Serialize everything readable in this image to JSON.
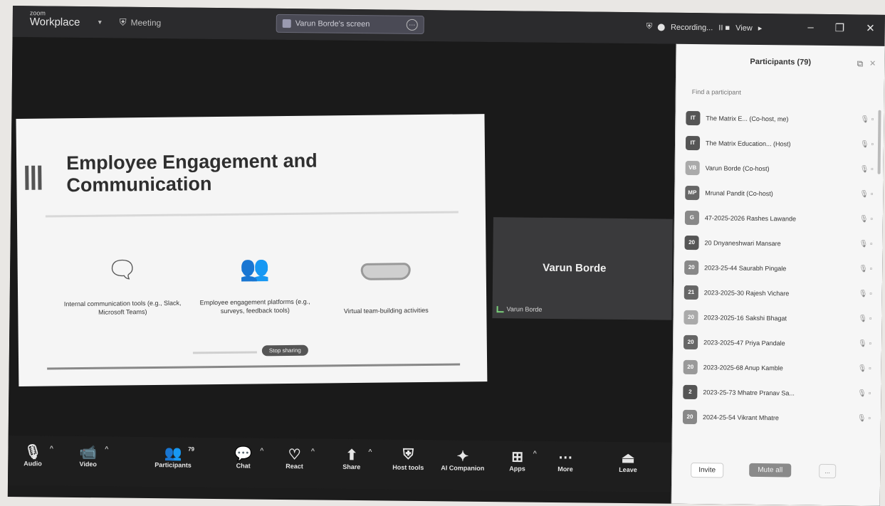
{
  "app": {
    "brand_small": "zoom",
    "brand": "Workplace",
    "meeting_label": "Meeting"
  },
  "screen_share_tab": {
    "label": "Varun Borde's screen"
  },
  "recording": {
    "label": "Recording...",
    "controls": "II ■",
    "view_label": "View"
  },
  "window_controls": {
    "minimize": "–",
    "maximize": "❐",
    "close": "✕"
  },
  "slide": {
    "title": "Employee Engagement and Communication",
    "items": [
      {
        "caption": "Internal communication tools (e.g., Slack, Microsoft Teams)",
        "icon": "chat-bubbles-icon"
      },
      {
        "caption": "Employee engagement platforms (e.g., surveys, feedback tools)",
        "icon": "people-group-icon"
      },
      {
        "caption": "Virtual team-building activities",
        "icon": "vr-headset-icon"
      }
    ],
    "pill_label": "Stop sharing"
  },
  "speaker": {
    "name": "Varun Borde",
    "label": "Varun Borde"
  },
  "toolbar": {
    "audio": "Audio",
    "video": "Video",
    "participants": "Participants",
    "participants_count": "79",
    "chat": "Chat",
    "react": "React",
    "share": "Share",
    "host_tools": "Host tools",
    "ai_companion": "AI Companion",
    "apps": "Apps",
    "more": "More",
    "leave": "Leave"
  },
  "panel": {
    "title": "Participants (79)",
    "search_placeholder": "Find a participant",
    "participants": [
      {
        "initials": "IT",
        "name": "The Matrix E... (Co-host, me)",
        "color": "#555555"
      },
      {
        "initials": "IT",
        "name": "The Matrix Education... (Host)",
        "color": "#555555"
      },
      {
        "initials": "VB",
        "name": "Varun Borde (Co-host)",
        "color": "#aaaaaa"
      },
      {
        "initials": "MP",
        "name": "Mrunal Pandit (Co-host)",
        "color": "#666666"
      },
      {
        "initials": "G",
        "name": "47-2025-2026 Rashes Lawande",
        "color": "#888888"
      },
      {
        "initials": "20",
        "name": "20 Dnyaneshwari Mansare",
        "color": "#555555"
      },
      {
        "initials": "20",
        "name": "2023-25-44 Saurabh Pingale",
        "color": "#888888"
      },
      {
        "initials": "21",
        "name": "2023-2025-30 Rajesh Vichare",
        "color": "#666666"
      },
      {
        "initials": "20",
        "name": "2023-2025-16 Sakshi Bhagat",
        "color": "#aaaaaa"
      },
      {
        "initials": "20",
        "name": "2023-2025-47 Priya Pandale",
        "color": "#666666"
      },
      {
        "initials": "20",
        "name": "2023-2025-68 Anup Kamble",
        "color": "#999999"
      },
      {
        "initials": "2",
        "name": "2023-25-73 Mhatre Pranav Sa...",
        "color": "#555555"
      },
      {
        "initials": "20",
        "name": "2024-25-54 Vikrant Mhatre",
        "color": "#888888"
      }
    ],
    "invite": "Invite",
    "mute_all": "Mute all",
    "more": "..."
  }
}
